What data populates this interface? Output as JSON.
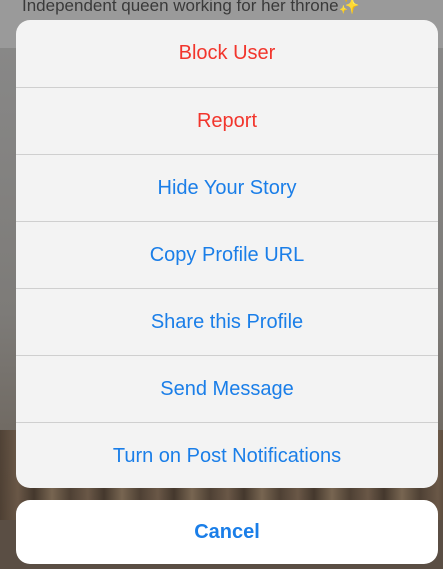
{
  "background": {
    "caption": "Independent queen working for her throne✨"
  },
  "action_sheet": {
    "items": [
      {
        "label": "Block User",
        "style": "destructive"
      },
      {
        "label": "Report",
        "style": "destructive"
      },
      {
        "label": "Hide Your Story",
        "style": "default"
      },
      {
        "label": "Copy Profile URL",
        "style": "default"
      },
      {
        "label": "Share this Profile",
        "style": "default"
      },
      {
        "label": "Send Message",
        "style": "default"
      },
      {
        "label": "Turn on Post Notifications",
        "style": "default"
      }
    ],
    "cancel_label": "Cancel"
  },
  "colors": {
    "destructive": "#f2352c",
    "accent": "#1a7ee8",
    "sheet_background": "#f3f3f3",
    "separator": "#cfcfcf"
  }
}
